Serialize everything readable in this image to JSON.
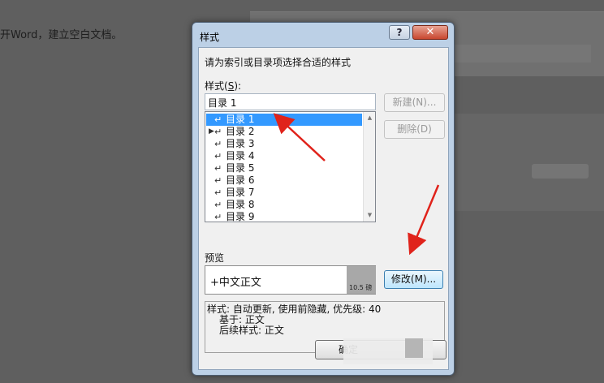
{
  "background": {
    "article_text": "开Word，建立空白文档。"
  },
  "dialog": {
    "title": "样式",
    "help_label": "?",
    "close_label": "✕",
    "instruction": "请为索引或目录项选择合适的样式",
    "styles_label": "样式(",
    "styles_shortcut": "S",
    "styles_label_end": "):",
    "style_input_value": "目录 1",
    "style_list": [
      {
        "label": "目录 1",
        "selected": true
      },
      {
        "label": "目录 2",
        "selected": false
      },
      {
        "label": "目录 3",
        "selected": false
      },
      {
        "label": "目录 4",
        "selected": false
      },
      {
        "label": "目录 5",
        "selected": false
      },
      {
        "label": "目录 6",
        "selected": false
      },
      {
        "label": "目录 7",
        "selected": false
      },
      {
        "label": "目录 8",
        "selected": false
      },
      {
        "label": "目录 9",
        "selected": false
      }
    ],
    "new_button": "新建(N)...",
    "delete_button": "删除(D)",
    "preview_label": "预览",
    "preview_text": "+中文正文",
    "preview_size": "10.5 磅",
    "modify_button": "修改(M)...",
    "description": {
      "line1": "样式: 自动更新, 使用前隐藏, 优先级: 40",
      "line2": "基于: 正文",
      "line3": "后续样式: 正文"
    },
    "ok_button": "确定"
  },
  "annotation_color": "#e0231b"
}
